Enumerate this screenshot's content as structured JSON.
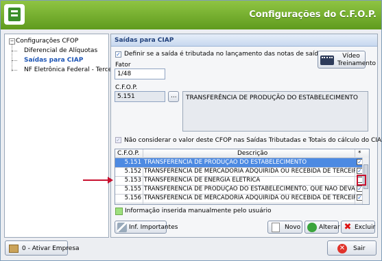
{
  "window": {
    "title": "Configurações do C.F.O.P."
  },
  "tree": {
    "root": "Configurações CFOP",
    "children": [
      "Diferencial de Alíquotas",
      "Saídas para CIAP",
      "NF Eletrônica Federal - Terce"
    ]
  },
  "panel": {
    "header": "Saídas para CIAP",
    "define_label": "Definir se a saída é tributada no lançamento das notas de saídas?",
    "define_checked": true,
    "video_button": [
      "Vídeo",
      "Treinamento"
    ],
    "fator_label": "Fator",
    "fator_value": "1/48",
    "cfop_label": "C.F.O.P.",
    "cfop_value": "5.151",
    "lookup_button": "...",
    "cfop_description": "TRANSFERÊNCIA DE PRODUÇÃO DO ESTABELECIMENTO",
    "nao_considerar_label": "Não considerar o valor deste CFOP nas Saídas Tributadas e Totais do cálculo do CIAP",
    "nao_considerar_checked": true
  },
  "grid": {
    "columns": [
      "C.F.O.P.",
      "Descrição",
      "*"
    ],
    "rows": [
      {
        "code": "5.151",
        "desc": "TRANSFERÊNCIA DE PRODUÇÃO DO ESTABELECIMENTO",
        "checked": true,
        "selected": true
      },
      {
        "code": "5.152",
        "desc": "TRANSFERÊNCIA DE MERCADORIA ADQUIRIDA OU RECEBIDA DE TERCEIROS",
        "checked": true,
        "selected": false
      },
      {
        "code": "5.153",
        "desc": "TRANSFERÊNCIA DE ENERGIA ELÉTRICA",
        "checked": false,
        "selected": false
      },
      {
        "code": "5.155",
        "desc": "TRANSFERÊNCIA DE PRODUÇÃO DO ESTABELECIMENTO, QUE NÃO DEVA POR ELE TR",
        "checked": true,
        "selected": false
      },
      {
        "code": "5.156",
        "desc": "TRANSFERÊNCIA DE MERCADORIA ADQUIRIDA OU RECEBIDA DE TERCEIROS, QUE N",
        "checked": true,
        "selected": false
      }
    ]
  },
  "legend": {
    "text": "Informação inserida manualmente pelo usuário",
    "color": "#9fe07e"
  },
  "buttons": {
    "inf_importantes": "Inf. Importantes",
    "novo": "Novo",
    "alterar": "Alterar",
    "excluir": "Excluir",
    "ativar_empresa": "0 - Ativar Empresa",
    "sair": "Sair"
  },
  "colors": {
    "accent": "#6ba824",
    "selection": "#4d8ae2",
    "highlight": "#c8102e"
  }
}
